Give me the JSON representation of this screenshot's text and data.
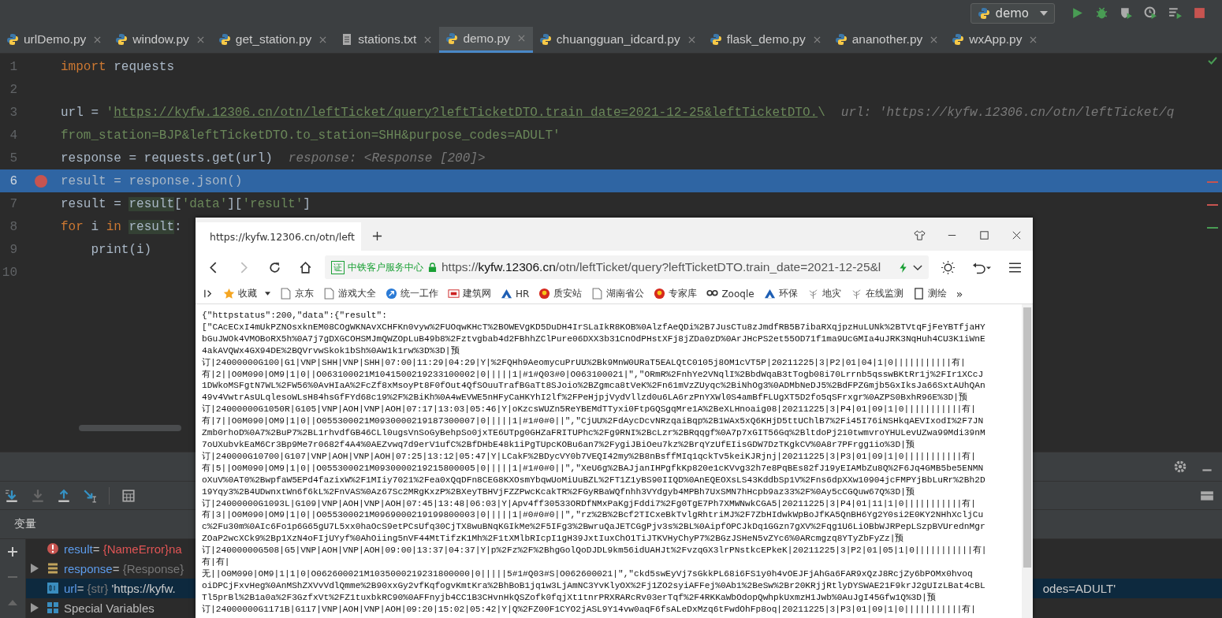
{
  "run_config": {
    "name": "demo"
  },
  "tabs": [
    {
      "label": "urlDemo.py",
      "kind": "python",
      "selected": false
    },
    {
      "label": "window.py",
      "kind": "python",
      "selected": false
    },
    {
      "label": "get_station.py",
      "kind": "python",
      "selected": false
    },
    {
      "label": "stations.txt",
      "kind": "text",
      "selected": false
    },
    {
      "label": "demo.py",
      "kind": "python",
      "selected": true
    },
    {
      "label": "chuangguan_idcard.py",
      "kind": "python",
      "selected": false
    },
    {
      "label": "flask_demo.py",
      "kind": "python",
      "selected": false
    },
    {
      "label": "ananother.py",
      "kind": "python",
      "selected": false
    },
    {
      "label": "wxApp.py",
      "kind": "python",
      "selected": false
    }
  ],
  "editor": {
    "lines": [
      {
        "number": "1",
        "current": false,
        "breakpoint": false,
        "tokens": [
          {
            "kind": "keyword",
            "text": "import"
          },
          {
            "kind": "plain",
            "text": " requests"
          }
        ]
      },
      {
        "number": "2",
        "current": false,
        "breakpoint": false
      },
      {
        "number": "3",
        "current": false,
        "breakpoint": false,
        "tokens": [
          {
            "kind": "plain",
            "text": "url = "
          },
          {
            "kind": "string",
            "text": "'"
          },
          {
            "kind": "url",
            "text": "https://kyfw.12306.cn/otn/leftTicket/query?leftTicketDTO.train_date=2021-12-25&leftTicketDTO."
          },
          {
            "kind": "string",
            "text": "\\"
          }
        ],
        "hint": "url: 'https://kyfw.12306.cn/otn/leftTicket/q"
      },
      {
        "number": "4",
        "current": false,
        "breakpoint": false,
        "tokens": [
          {
            "kind": "string",
            "text": "from_station=BJP&leftTicketDTO.to_station=SHH&purpose_codes=ADULT'"
          }
        ]
      },
      {
        "number": "5",
        "current": false,
        "breakpoint": false,
        "tokens": [
          {
            "kind": "plain",
            "text": "response = requests.get(url)"
          }
        ],
        "hint": "response: <Response [200]>"
      },
      {
        "number": "6",
        "current": true,
        "breakpoint": true,
        "tokens": [
          {
            "kind": "plain",
            "text": "result = response.json()"
          }
        ]
      },
      {
        "number": "7",
        "current": false,
        "breakpoint": false,
        "tokens": [
          {
            "kind": "plain",
            "text": "result = "
          },
          {
            "kind": "usage",
            "text": "result"
          },
          {
            "kind": "plain",
            "text": "["
          },
          {
            "kind": "string",
            "text": "'data'"
          },
          {
            "kind": "plain",
            "text": "]["
          },
          {
            "kind": "string",
            "text": "'result'"
          },
          {
            "kind": "plain",
            "text": "]"
          }
        ]
      },
      {
        "number": "8",
        "current": false,
        "breakpoint": false,
        "tokens": [
          {
            "kind": "keyword",
            "text": "for"
          },
          {
            "kind": "plain",
            "text": " i "
          },
          {
            "kind": "keyword",
            "text": "in "
          },
          {
            "kind": "usage",
            "text": "result"
          },
          {
            "kind": "plain",
            "text": ":"
          }
        ]
      },
      {
        "number": "9",
        "current": false,
        "breakpoint": false,
        "tokens": [
          {
            "kind": "plain",
            "text": "    print(i)"
          }
        ]
      },
      {
        "number": "10",
        "current": false,
        "breakpoint": false
      }
    ],
    "markers": [
      {
        "color": "#c75450"
      },
      {
        "color": "#c75450"
      },
      {
        "color": "#499c54"
      }
    ]
  },
  "debugger": {
    "panel_title": "变量",
    "variables": [
      {
        "kind": "error",
        "name": "result",
        "equals": "=",
        "type": "{NameError}",
        "value": "na"
      },
      {
        "kind": "object",
        "name": "response",
        "equals": "=",
        "type": "{Response}"
      },
      {
        "kind": "string",
        "name": "url",
        "equals": "=",
        "type": "{str}",
        "value": "'https://kyfw.",
        "value_tail": "odes=ADULT'",
        "selected": true
      },
      {
        "kind": "special",
        "name": "Special Variables"
      }
    ]
  },
  "browser": {
    "tab_title": "https://kyfw.12306.cn/otn/left",
    "site_badge": "证",
    "site_name": "中铁客户服务中心",
    "address": {
      "scheme": "https://",
      "host": "kyfw.12306.cn",
      "path": "/otn/leftTicket/query?leftTicketDTO.train_date=2021-12-25&l"
    },
    "bookmarks": [
      {
        "kind": "star",
        "label": "收藏"
      },
      {
        "kind": "page",
        "label": "京东"
      },
      {
        "kind": "page",
        "label": "游戏大全"
      },
      {
        "kind": "blue",
        "label": "统一工作"
      },
      {
        "kind": "cbi",
        "label": "建筑网"
      },
      {
        "kind": "triangle",
        "label": "HR"
      },
      {
        "kind": "emblem",
        "label": "质安站"
      },
      {
        "kind": "page",
        "label": "湖南省公"
      },
      {
        "kind": "emblem",
        "label": "专家库"
      },
      {
        "kind": "qq",
        "label": "Zooqle"
      },
      {
        "kind": "triangle",
        "label": "环保"
      },
      {
        "kind": "plant",
        "label": "地灾"
      },
      {
        "kind": "plant",
        "label": "在线监测"
      },
      {
        "kind": "doc",
        "label": "测绘"
      }
    ],
    "more": "»",
    "content": [
      "{\"httpstatus\":200,\"data\":{\"result\":",
      "[\"CAcECxI4mUkPZNOsxknEM08COgWKNAvXCHFKn0vyw%2FUOqwKHcT%2BOWEVgKD5DuDH4IrSLaIkR8KOB%0AlzfAeQDi%2B7JusCTu8zJmdfRB5B7ibaRXqjpzHuLUNk%2BTVtqFjFeYBTfjaHY",
      "bGuJWOk4VMOBoRX5h%0A7j7gDXGCOHSMJmQWZOpLuB49b8%2Fztvgbab4d2FBhhZClPure06DXX3b31CnOdPHstXFj8jZDa0zD%0ArJHcPS2et55OD71f1ma9UcGMIa4uJRK3NqHuh4CU3K1iWnE",
      "4akAVQWx4GX94DE%2BQVrvwSkok1bSh%0AW1k1rw%3D%3D|预",
      "订|24000000G100|G1|VNP|SHH|VNP|SHH|07:00|11:29|04:29|Y|%2FQHh9AeomycuPrUU%2Bk9MnW0URaT5EALQtC0105j8OM1cVT5P|20211225|3|P2|01|04|1|0|||||||||||有|",
      "有|2||O0M090|OM9|1|0||O063100021M1041500219233100002|0|||||1|#1#Q03#0|O063100021|\",\"ORmR%2FnhYe2VNqlI%2BbdWqaB3tTogb08i70Lrrnb5qsswBKtRr1j%2FIr1XCcJ",
      "1DWkoMSFgtN7WL%2FW56%0AvHIaA%2FcZf8xMsoyPt8F0fOut4QfSOuuTrafBGaTt8SJoio%2BZgmca8tVeK%2Fn61mVzZUyqc%2BiNhOg3%0ADMbNeDJ5%2BdFPZGmjb5GxIksJa66SxtAUhQAn",
      "49v4VwtrAsULqlesoWLsH84hsGfFYd68c19%2F%2BiKh%0A4wEVWE5nHFyCaHKYhI2lf%2FPeHjpjVydVllzd0u6LA6rzPnYXWl0S4amBfFLUgXT5D2fo5qSFrxgr%0AZPS0BxhR96E%3D|预",
      "订|24000000G1050R|G105|VNP|AOH|VNP|AOH|07:17|13:03|05:46|Y|oKzcsWUZn5ReYBEMdTTyxi0FtpGQSgqMre1A%2BeXLHnoaig08|20211225|3|P4|01|09|1|0|||||||||||有|",
      "有|7||O0M090|OM9|1|0||O055300021M0930000219187300007|0|||||1|#1#0#0||\",\"CjUU%2FdAycDcvNRzqaiBqp%2B1WAx5xQ6KHjD5ttUChlB7%2Fi45I76iNSHkqAEVIxodI%2F7JN",
      "Zmb0rhoD%0A7%2BuP7%2BL1rhvdfGB46CLl0ugsVnSoGyBehpSo0jxTE6UTpg0GHZaFRITUPhc%2Fg9RNI%2BcLzr%2BRqqgf%0A7p7xGIT56Gq%2BltdoPj210twmvroYHULevUZwa99Mdi39nM",
      "7oUXubvkEaM6Cr3Bp9Me7r0682f4A4%0AEZvwq7d9erV1ufC%2BfDHbE48k1iPgTUpcKOBu6an7%2FygiJBiOeu7kz%2BrqYzUfEIisGDW7DzTKgkCV%0A8r7PFrgg1io%3D|预",
      "订|240000G10700|G107|VNP|AOH|VNP|AOH|07:25|13:12|05:47|Y|LCakF%2BDycVY0b7VEQI42my%2B8nBsffMIq1qckTv5keiKJRjnj|20211225|3|P3|01|09|1|0|||||||||||有|",
      "有|5||O0M090|OM9|1|0||O055300021M0930000219215800005|0|||||1|#1#0#0||\",\"XeU6g%2BAJjanIHPgfkKp820e1cKVvg32h7e8PqBEs82fJ19yEIAMbZu8Q%2F6Jq4GMB5be5ENMN",
      "oXuV%0AT0%2BwpfaW5EPd4fazixW%2F1MIiy7021%2Fea0xQqDFn8CEG8KXOsmYbqwUoMiUuBZL%2FT1Z1yBS90IIQD%0AnEQEOXsLS43KddbSp1V%2Fns6dpXXw10904jcFMPYjBbLuRr%2Bh2D",
      "19Yqy3%2B4UDwnxtWn6f6kL%2FnVAS%0Az67Sc2MRgKxzP%2BXeyTBHVjFZZPwcKcakTR%2FGyRBaWQfnhh3VYdgyb4MPBh7UxSMN7hHcpb9az33%2F%0Ay5cCGQuw67Q%3D|预",
      "订|24000000G1093L|G109|VNP|AOH|VNP|AOH|07:45|13:48|06:03|Y|Apv4ff30533ORDfNMxPaKgjFddi7%2Fg0TgE7Ph7XMWNwkCGA5|20211225|3|P4|01|11|1|0|||||||||||有|",
      "有|3||O0M090|OM9|1|0||O055300021M0969000219199800003|0|||||1|#0#0#0||\",\"rz%2B%2Bcf2TICxeBkTvlgRhtriMJ%2F7ZbHIdwkWpBoJfKA5QnBH6Yg2Y0si2E0KY2NHhXcljCu",
      "c%2Fu30m%0AIc6Fo1p6G65gU7L5xx0haOcS9etPCsUfq30CjTX8wuBNqKGIkMe%2F5IFg3%2BwruQaJETCGgPjv3s%2BL%0AipfOPCJkDq1GGzn7gXV%2Fqg1U6LiOBbWJRPepLSzpBVUrednMgr",
      "ZOaP2wcXCk9%2Bp1XzN4oFIjUYyf%0AhOiing5nVF44MtTifzK1Mh%2F1tXMlbRIcpI1gH39JxtIuxChO1TiJTKVHyChyP7%2BGzJSHeN5vZYc6%0ARcmgzq8YTyZbFyZz|预",
      "订|24000000G508|G5|VNP|AOH|VNP|AOH|09:00|13:37|04:37|Y|p%2Fz%2F%2BhgGolQoDJDL9km56idUAHJt%2FvzqGX3lrPNstkcEPkeK|20211225|3|P2|01|05|1|0|||||||||||有|",
      "有|有|",
      "无||O0M090|OM9|1|1|0|O062600021M1035000219231800000|0|||||5#1#Q03#S|O062600021|\",\"ckd5swEyVj7sGkkPL68i6FS1y0h4vOEJFjAhGa6FAR9xQzJ8RcjZy6bPOMx0hvoq",
      "oiDPCjFxvHeg%0AnMShZXVvVdlQmme%2B90xxGy2vfKqfogvKmtKra%2BhBoB1jq1w3LjAmNC3YvKlyOX%2Fj1ZO2syiAFFej%0Ab1%2BeSw%2Br20KRjjRtlyDYSWAE21F9krJ2gUIzLBat4cBL",
      "Tl5prBl%2B1a0a%2F3GzfxVt%2FZ1tuxbkRC90%0AFFnyjb4CC1B3CHvnHkQSZofk0fqjXt1tnrPRXRARcRv03erTqf%2F4RKKaWbOdopQwhpkUxmzH1Jwb%0AuJgI45Gfw1Q%3D|预",
      "订|24000000G1171B|G117|VNP|AOH|VNP|AOH|09:20|15:02|05:42|Y|Q%2FZ00F1CYO2jASL9Y14vw0aqF6fsALeDxMzq6tFwdOhFp8oq|20211225|3|P3|01|09|1|0|||||||||||有|"
    ]
  }
}
